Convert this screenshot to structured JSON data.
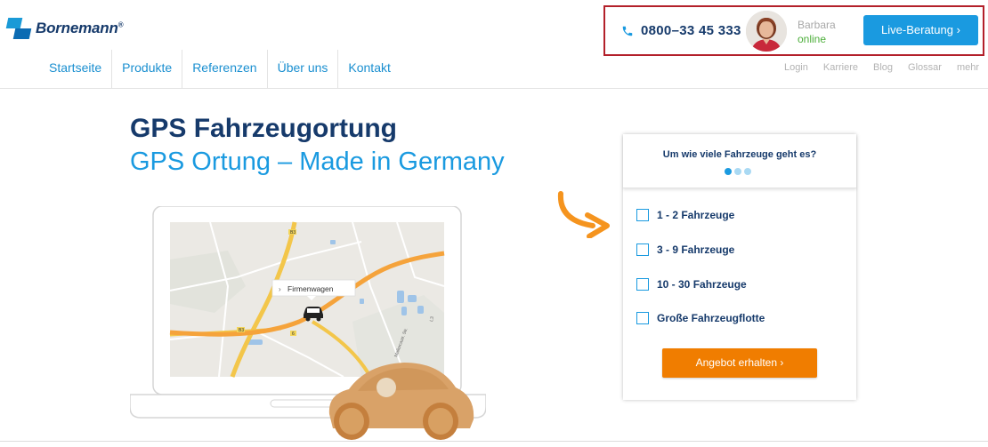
{
  "brand": {
    "name": "Bornemann",
    "reg": "®"
  },
  "nav": {
    "items": [
      "Startseite",
      "Produkte",
      "Referenzen",
      "Über uns",
      "Kontakt"
    ]
  },
  "subnav": {
    "items": [
      "Login",
      "Karriere",
      "Blog",
      "Glossar",
      "mehr"
    ]
  },
  "contact": {
    "phone": "0800–33 45 333",
    "agent_name": "Barbara",
    "agent_status": "online",
    "live_button": "Live-Beratung ›"
  },
  "hero": {
    "title": "GPS Fahrzeugortung",
    "subtitle": "GPS Ortung – Made in Germany"
  },
  "map": {
    "label": "Firmenwagen",
    "road_labels": [
      "B3",
      "B3",
      "6",
      "L3",
      "Mallorcastr. Str."
    ]
  },
  "form": {
    "question": "Um wie viele Fahrzeuge geht es?",
    "step": 1,
    "steps_total": 3,
    "options": [
      "1 - 2 Fahrzeuge",
      "3 - 9 Fahrzeuge",
      "10 - 30 Fahrzeuge",
      "Große Fahrzeugflotte"
    ],
    "submit": "Angebot erhalten ›"
  },
  "colors": {
    "brand_blue": "#1a9ae0",
    "navy": "#163a6b",
    "orange": "#f07d00",
    "online": "#4cae3a"
  }
}
